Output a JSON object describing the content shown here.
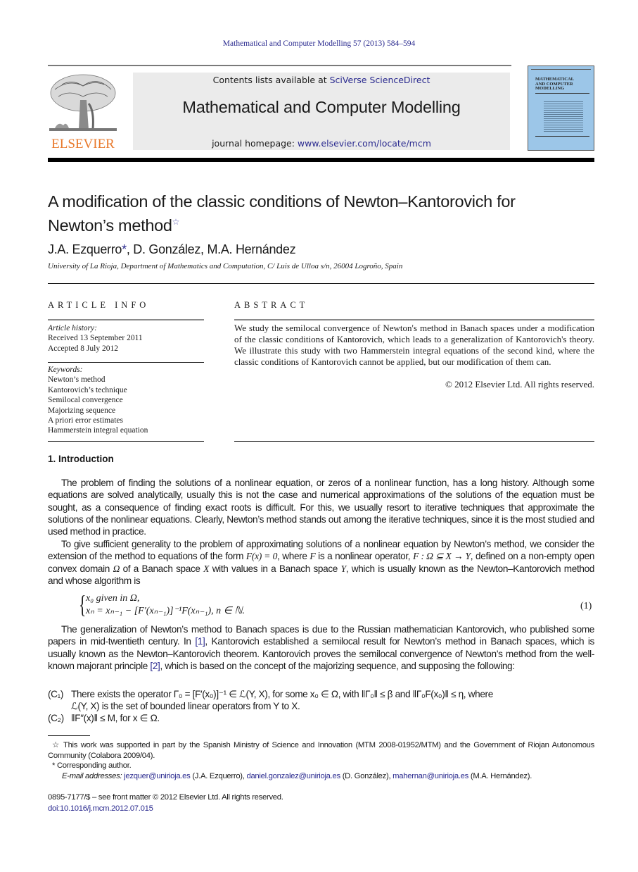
{
  "running_head": "Mathematical and Computer Modelling 57 (2013) 584–594",
  "masthead": {
    "publisher_logo_text": "ELSEVIER",
    "contents_prefix": "Contents lists available at ",
    "contents_link": "SciVerse ScienceDirect",
    "journal_title": "Mathematical and Computer Modelling",
    "homepage_prefix": "journal homepage: ",
    "homepage_link": "www.elsevier.com/locate/mcm",
    "cover_title_lines": [
      "MATHEMATICAL",
      "AND COMPUTER",
      "MODELLING"
    ],
    "colors": {
      "publisher_orange": "#e8782a",
      "link_blue": "#2a2a8f",
      "cover_blue": "#9cc6e8"
    }
  },
  "article": {
    "title_line1": "A modification of the classic conditions of Newton–Kantorovich for",
    "title_line2": "Newton’s method",
    "title_note_mark": "☆",
    "authors": [
      {
        "name": "J.A. Ezquerro",
        "mark": "*"
      },
      {
        "name": "D. González",
        "mark": ""
      },
      {
        "name": "M.A. Hernández",
        "mark": ""
      }
    ],
    "author_sep": ", ",
    "affiliation": "University of La Rioja, Department of Mathematics and Computation, C/ Luis de Ulloa s/n, 26004 Logroño, Spain"
  },
  "article_info": {
    "heading": "ARTICLE INFO",
    "history_label": "Article history:",
    "received": "Received 13 September 2011",
    "accepted": "Accepted 8 July 2012",
    "keywords_label": "Keywords:",
    "keywords": [
      "Newton’s method",
      "Kantorovich’s technique",
      "Semilocal convergence",
      "Majorizing sequence",
      "A priori error estimates",
      "Hammerstein integral equation"
    ]
  },
  "abstract": {
    "heading": "ABSTRACT",
    "text": "We study the semilocal convergence of Newton's method in Banach spaces under a modification of the classic conditions of Kantorovich, which leads to a generalization of Kantorovich's theory. We illustrate this study with two Hammerstein integral equations of the second kind, where the classic conditions of Kantorovich cannot be applied, but our modification of them can.",
    "copyright": "© 2012 Elsevier Ltd. All rights reserved."
  },
  "introduction": {
    "heading": "1.  Introduction",
    "para1": "The problem of finding the solutions of a nonlinear equation, or zeros of a nonlinear function, has a long history. Although some equations are solved analytically, usually this is not the case and numerical approximations of the solutions of the equation must be sought, as a consequence of finding exact roots is difficult. For this, we usually resort to iterative techniques that approximate the solutions of the nonlinear equations. Clearly, Newton’s method stands out among the iterative techniques, since it is the most studied and used method in practice.",
    "para2_a": "To give sufficient generality to the problem of approximating solutions of a nonlinear equation by Newton’s method, we consider the extension of the method to equations of the form ",
    "para2_fx": "F(x) = 0",
    "para2_b": ", where ",
    "para2_F": "F",
    "para2_c": " is a nonlinear operator, ",
    "para2_map": "F : Ω ⊆ X → Y",
    "para2_d": ", defined on a non-empty open convex domain ",
    "para2_omega": "Ω",
    "para2_e": " of a Banach space ",
    "para2_X": "X",
    "para2_f": " with values in a Banach space ",
    "para2_Y": "Y",
    "para2_g": ", which is usually known as the Newton–Kantorovich method and whose algorithm is",
    "equation_row1": "x₀   given in Ω,",
    "equation_row2": "xₙ = xₙ₋₁ − [F′(xₙ₋₁)]⁻¹F(xₙ₋₁),    n ∈ ℕ.",
    "equation_number": "(1)",
    "para3_a": "The generalization of Newton’s method to Banach spaces is due to the Russian mathematician Kantorovich, who published some papers in mid-twentieth century. In ",
    "ref1": "[1]",
    "para3_b": ", Kantorovich established a semilocal result for Newton’s method in Banach spaces, which is usually known as the Newton–Kantorovich theorem. Kantorovich proves the semilocal convergence of Newton’s method from the well-known majorant principle ",
    "ref2": "[2]",
    "para3_c": ", which is based on the concept of the majorizing sequence, and supposing the following:",
    "conditions": [
      {
        "tag": "(C₁)",
        "text": "There exists the operator Γ₀ = [F′(x₀)]⁻¹ ∈ ℒ(Y, X), for some x₀ ∈ Ω, with ‖Γ₀‖ ≤ β and ‖Γ₀F(x₀)‖ ≤ η, where",
        "cont": "ℒ(Y, X) is the set of bounded linear operators from Y to X."
      },
      {
        "tag": "(C₂)",
        "text": "‖F″(x)‖ ≤ M, for x ∈ Ω.",
        "cont": ""
      }
    ]
  },
  "footnotes": {
    "star_mark": "☆",
    "star_text": "This work was supported in part by the Spanish Ministry of Science and Innovation (MTM 2008-01952/MTM) and the Government of Riojan Autonomous Community (Colabora 2009/04).",
    "ast_mark": "*",
    "ast_text": "Corresponding author.",
    "email_label": "E-mail addresses:",
    "emails": [
      {
        "address": "jezquer@unirioja.es",
        "owner": "(J.A. Ezquerro)"
      },
      {
        "address": "daniel.gonzalez@unirioja.es",
        "owner": "(D. González)"
      },
      {
        "address": "mahernan@unirioja.es",
        "owner": "(M.A. Hernández)."
      }
    ]
  },
  "front_matter": {
    "issn_line": "0895-7177/$ – see front matter © 2012 Elsevier Ltd. All rights reserved.",
    "doi": "doi:10.1016/j.mcm.2012.07.015"
  }
}
